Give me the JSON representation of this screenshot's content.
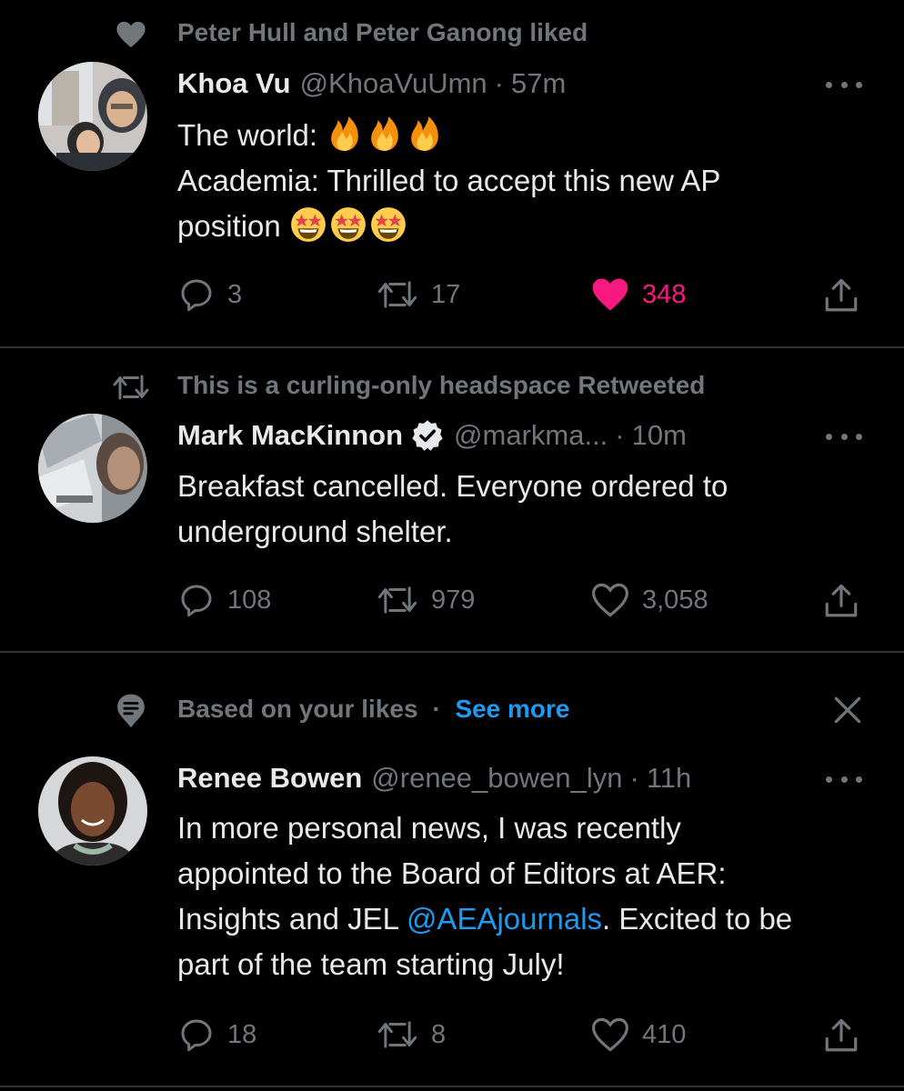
{
  "colors": {
    "background": "#000000",
    "text": "#e7e9ea",
    "muted": "#71767b",
    "accent": "#1d9bf0",
    "like": "#f91880",
    "divider": "#2f3336"
  },
  "tweets": [
    {
      "context": "Peter Hull and Peter Ganong liked",
      "context_icon": "heart-icon",
      "name": "Khoa Vu",
      "handle": "@KhoaVuUmn",
      "time": "57m",
      "line1": "The world:",
      "line1_emoji": [
        "fire",
        "fire",
        "fire"
      ],
      "line2": "Academia: Thrilled to accept this new AP",
      "line3": "position",
      "line3_emoji": [
        "star-struck",
        "star-struck",
        "star-struck"
      ],
      "replies": "3",
      "retweets": "17",
      "likes": "348",
      "liked": true
    },
    {
      "context": "This is a curling-only headspace Retweeted",
      "context_icon": "retweet-icon",
      "name": "Mark MacKinnon",
      "verified": true,
      "handle": "@markma...",
      "time": "10m",
      "line1": "Breakfast cancelled. Everyone ordered to",
      "line2": "underground shelter.",
      "replies": "108",
      "retweets": "979",
      "likes": "3,058",
      "liked": false
    },
    {
      "context": "Based on your likes",
      "context_icon": "topic-icon",
      "see_more": "See more",
      "name": "Renee Bowen",
      "handle": "@renee_bowen_lyn",
      "time": "11h",
      "line1": "In more personal news, I was recently",
      "line2": "appointed to the Board of Editors at AER:",
      "line3_pre": "Insights and JEL ",
      "line3_link": "@AEAjournals",
      "line3_post": ". Excited to be",
      "line4": "part of the team starting July!",
      "replies": "18",
      "retweets": "8",
      "likes": "410",
      "liked": false
    }
  ],
  "separator": "·"
}
